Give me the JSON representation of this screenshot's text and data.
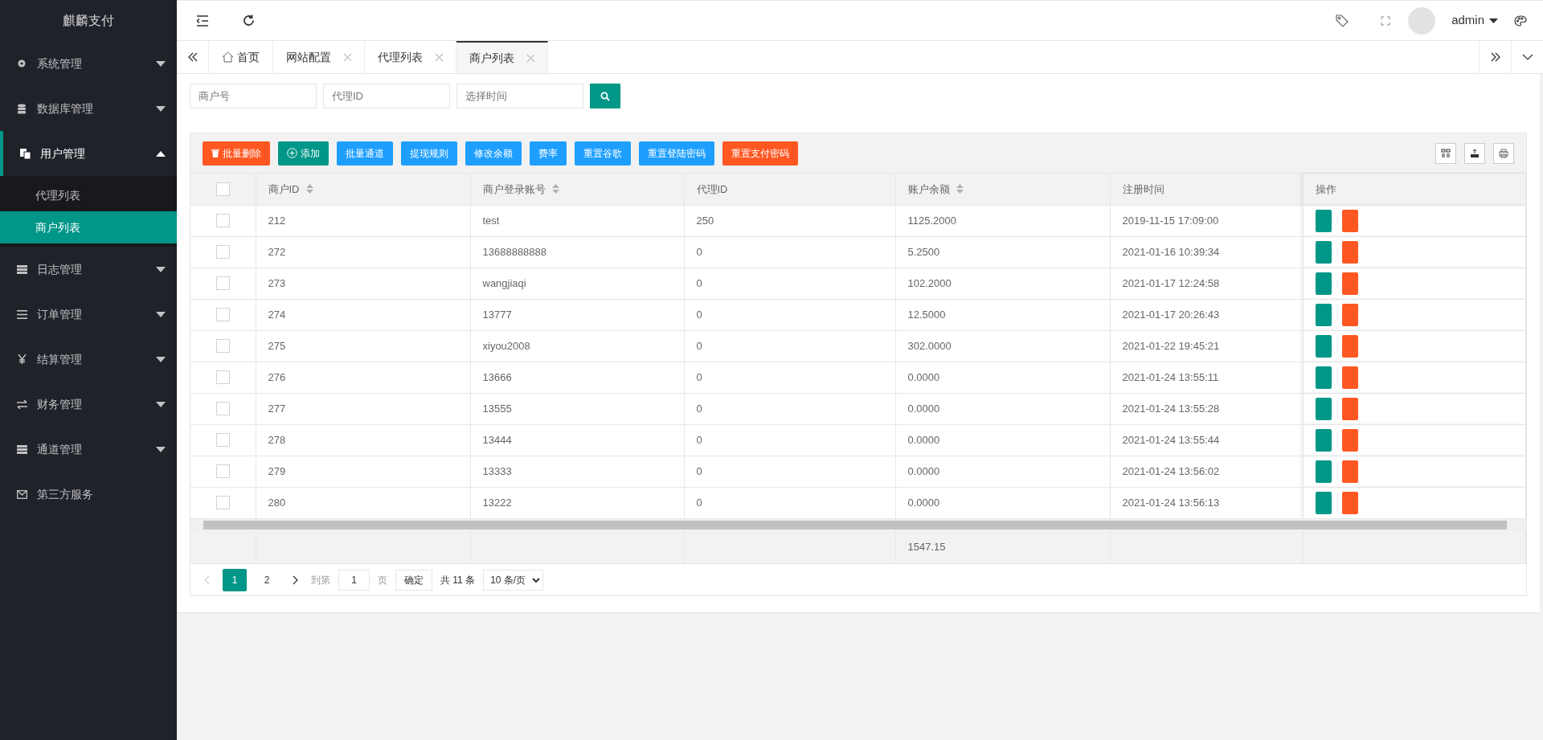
{
  "sidebar": {
    "logo": "麒麟支付",
    "items": [
      {
        "label": "系统管理",
        "collapsible": true,
        "expanded": false
      },
      {
        "label": "数据库管理",
        "collapsible": true,
        "expanded": false
      },
      {
        "label": "用户管理",
        "collapsible": true,
        "expanded": true,
        "children": [
          {
            "label": "代理列表",
            "selected": false
          },
          {
            "label": "商户列表",
            "selected": true
          }
        ]
      },
      {
        "label": "日志管理",
        "collapsible": true,
        "expanded": false
      },
      {
        "label": "订单管理",
        "collapsible": true,
        "expanded": false
      },
      {
        "label": "结算管理",
        "collapsible": true,
        "expanded": false
      },
      {
        "label": "财务管理",
        "collapsible": true,
        "expanded": false
      },
      {
        "label": "通道管理",
        "collapsible": true,
        "expanded": false
      },
      {
        "label": "第三方服务",
        "collapsible": false,
        "expanded": false
      }
    ]
  },
  "header": {
    "user": "admin"
  },
  "tabs": [
    {
      "label": "首页",
      "selected": false,
      "closable": false
    },
    {
      "label": "网站配置",
      "selected": false,
      "closable": true
    },
    {
      "label": "代理列表",
      "selected": false,
      "closable": true
    },
    {
      "label": "商户列表",
      "selected": true,
      "closable": true
    }
  ],
  "search": [
    {
      "placeholder": "商户号"
    },
    {
      "placeholder": "代理ID"
    },
    {
      "placeholder": "选择时间"
    }
  ],
  "toolbar": [
    {
      "label": "批量删除",
      "kind": "danger"
    },
    {
      "label": "添加",
      "kind": "primary"
    },
    {
      "label": "批量通道",
      "kind": "info"
    },
    {
      "label": "提现规则",
      "kind": "info"
    },
    {
      "label": "修改余额",
      "kind": "info"
    },
    {
      "label": "费率",
      "kind": "info"
    },
    {
      "label": "重置谷歌",
      "kind": "info"
    },
    {
      "label": "重置登陆密码",
      "kind": "info"
    },
    {
      "label": "重置支付密码",
      "kind": "danger"
    }
  ],
  "table": {
    "select_all_checked": false,
    "columns": [
      {
        "label": "商户ID",
        "sortable": true
      },
      {
        "label": "商户登录账号",
        "sortable": true
      },
      {
        "label": "代理ID",
        "sortable": false
      },
      {
        "label": "账户余额",
        "sortable": true
      },
      {
        "label": "注册时间",
        "sortable": false
      },
      {
        "label": "操作",
        "sortable": false
      }
    ],
    "rows": [
      {
        "checked": false,
        "cells": [
          "212",
          "test",
          "250",
          "1125.2000",
          "2019-11-15 17:09:00"
        ]
      },
      {
        "checked": false,
        "cells": [
          "272",
          "13688888888",
          "0",
          "5.2500",
          "2021-01-16 10:39:34"
        ]
      },
      {
        "checked": false,
        "cells": [
          "273",
          "wangjiaqi",
          "0",
          "102.2000",
          "2021-01-17 12:24:58"
        ]
      },
      {
        "checked": false,
        "cells": [
          "274",
          "13777",
          "0",
          "12.5000",
          "2021-01-17 20:26:43"
        ]
      },
      {
        "checked": false,
        "cells": [
          "275",
          "xiyou2008",
          "0",
          "302.0000",
          "2021-01-22 19:45:21"
        ]
      },
      {
        "checked": false,
        "cells": [
          "276",
          "13666",
          "0",
          "0.0000",
          "2021-01-24 13:55:11"
        ]
      },
      {
        "checked": false,
        "cells": [
          "277",
          "13555",
          "0",
          "0.0000",
          "2021-01-24 13:55:28"
        ]
      },
      {
        "checked": false,
        "cells": [
          "278",
          "13444",
          "0",
          "0.0000",
          "2021-01-24 13:55:44"
        ]
      },
      {
        "checked": false,
        "cells": [
          "279",
          "13333",
          "0",
          "0.0000",
          "2021-01-24 13:56:02"
        ]
      },
      {
        "checked": false,
        "cells": [
          "280",
          "13222",
          "0",
          "0.0000",
          "2021-01-24 13:56:13"
        ]
      }
    ],
    "total_balance": "1547.15"
  },
  "pager": {
    "pages": [
      {
        "label": "1",
        "selected": true
      },
      {
        "label": "2",
        "selected": false
      }
    ],
    "prev_disabled": true,
    "goto_label": "到第",
    "goto_value": "1",
    "page_unit": "页",
    "confirm": "确定",
    "total": "共 11 条",
    "page_size": "10 条/页"
  }
}
